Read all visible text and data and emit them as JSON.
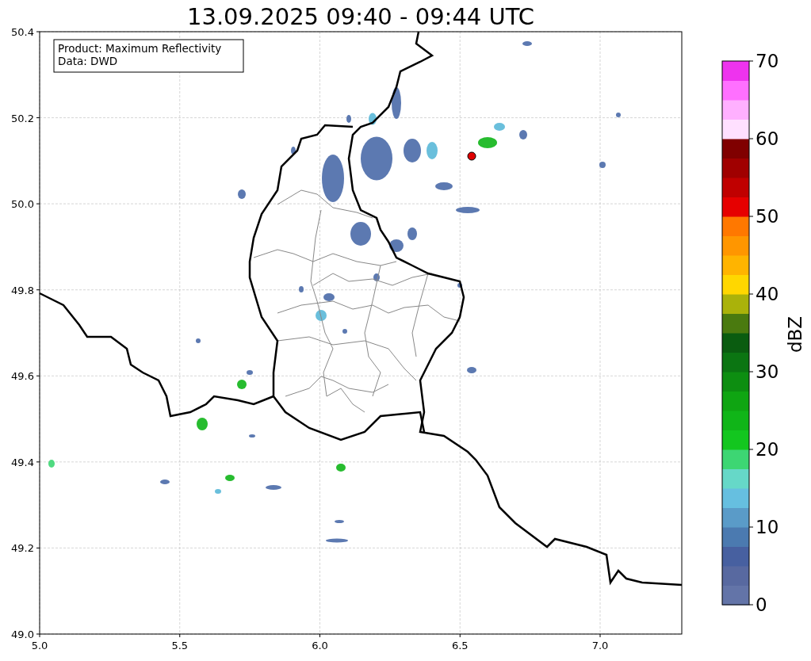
{
  "title": "13.09.2025 09:40 - 09:44 UTC",
  "info_box": [
    "Product: Maximum Reflectivity",
    "Data: DWD"
  ],
  "x_ticks": [
    "5.0",
    "5.5",
    "6.0",
    "6.5",
    "7.0"
  ],
  "y_ticks": [
    "50.4",
    "50.2",
    "50.0",
    "49.8",
    "49.6",
    "49.4",
    "49.2",
    "49.0"
  ],
  "colorbar": {
    "label": "dBZ",
    "ticks": [
      "70",
      "60",
      "50",
      "40",
      "30",
      "20",
      "10",
      "0"
    ]
  }
}
